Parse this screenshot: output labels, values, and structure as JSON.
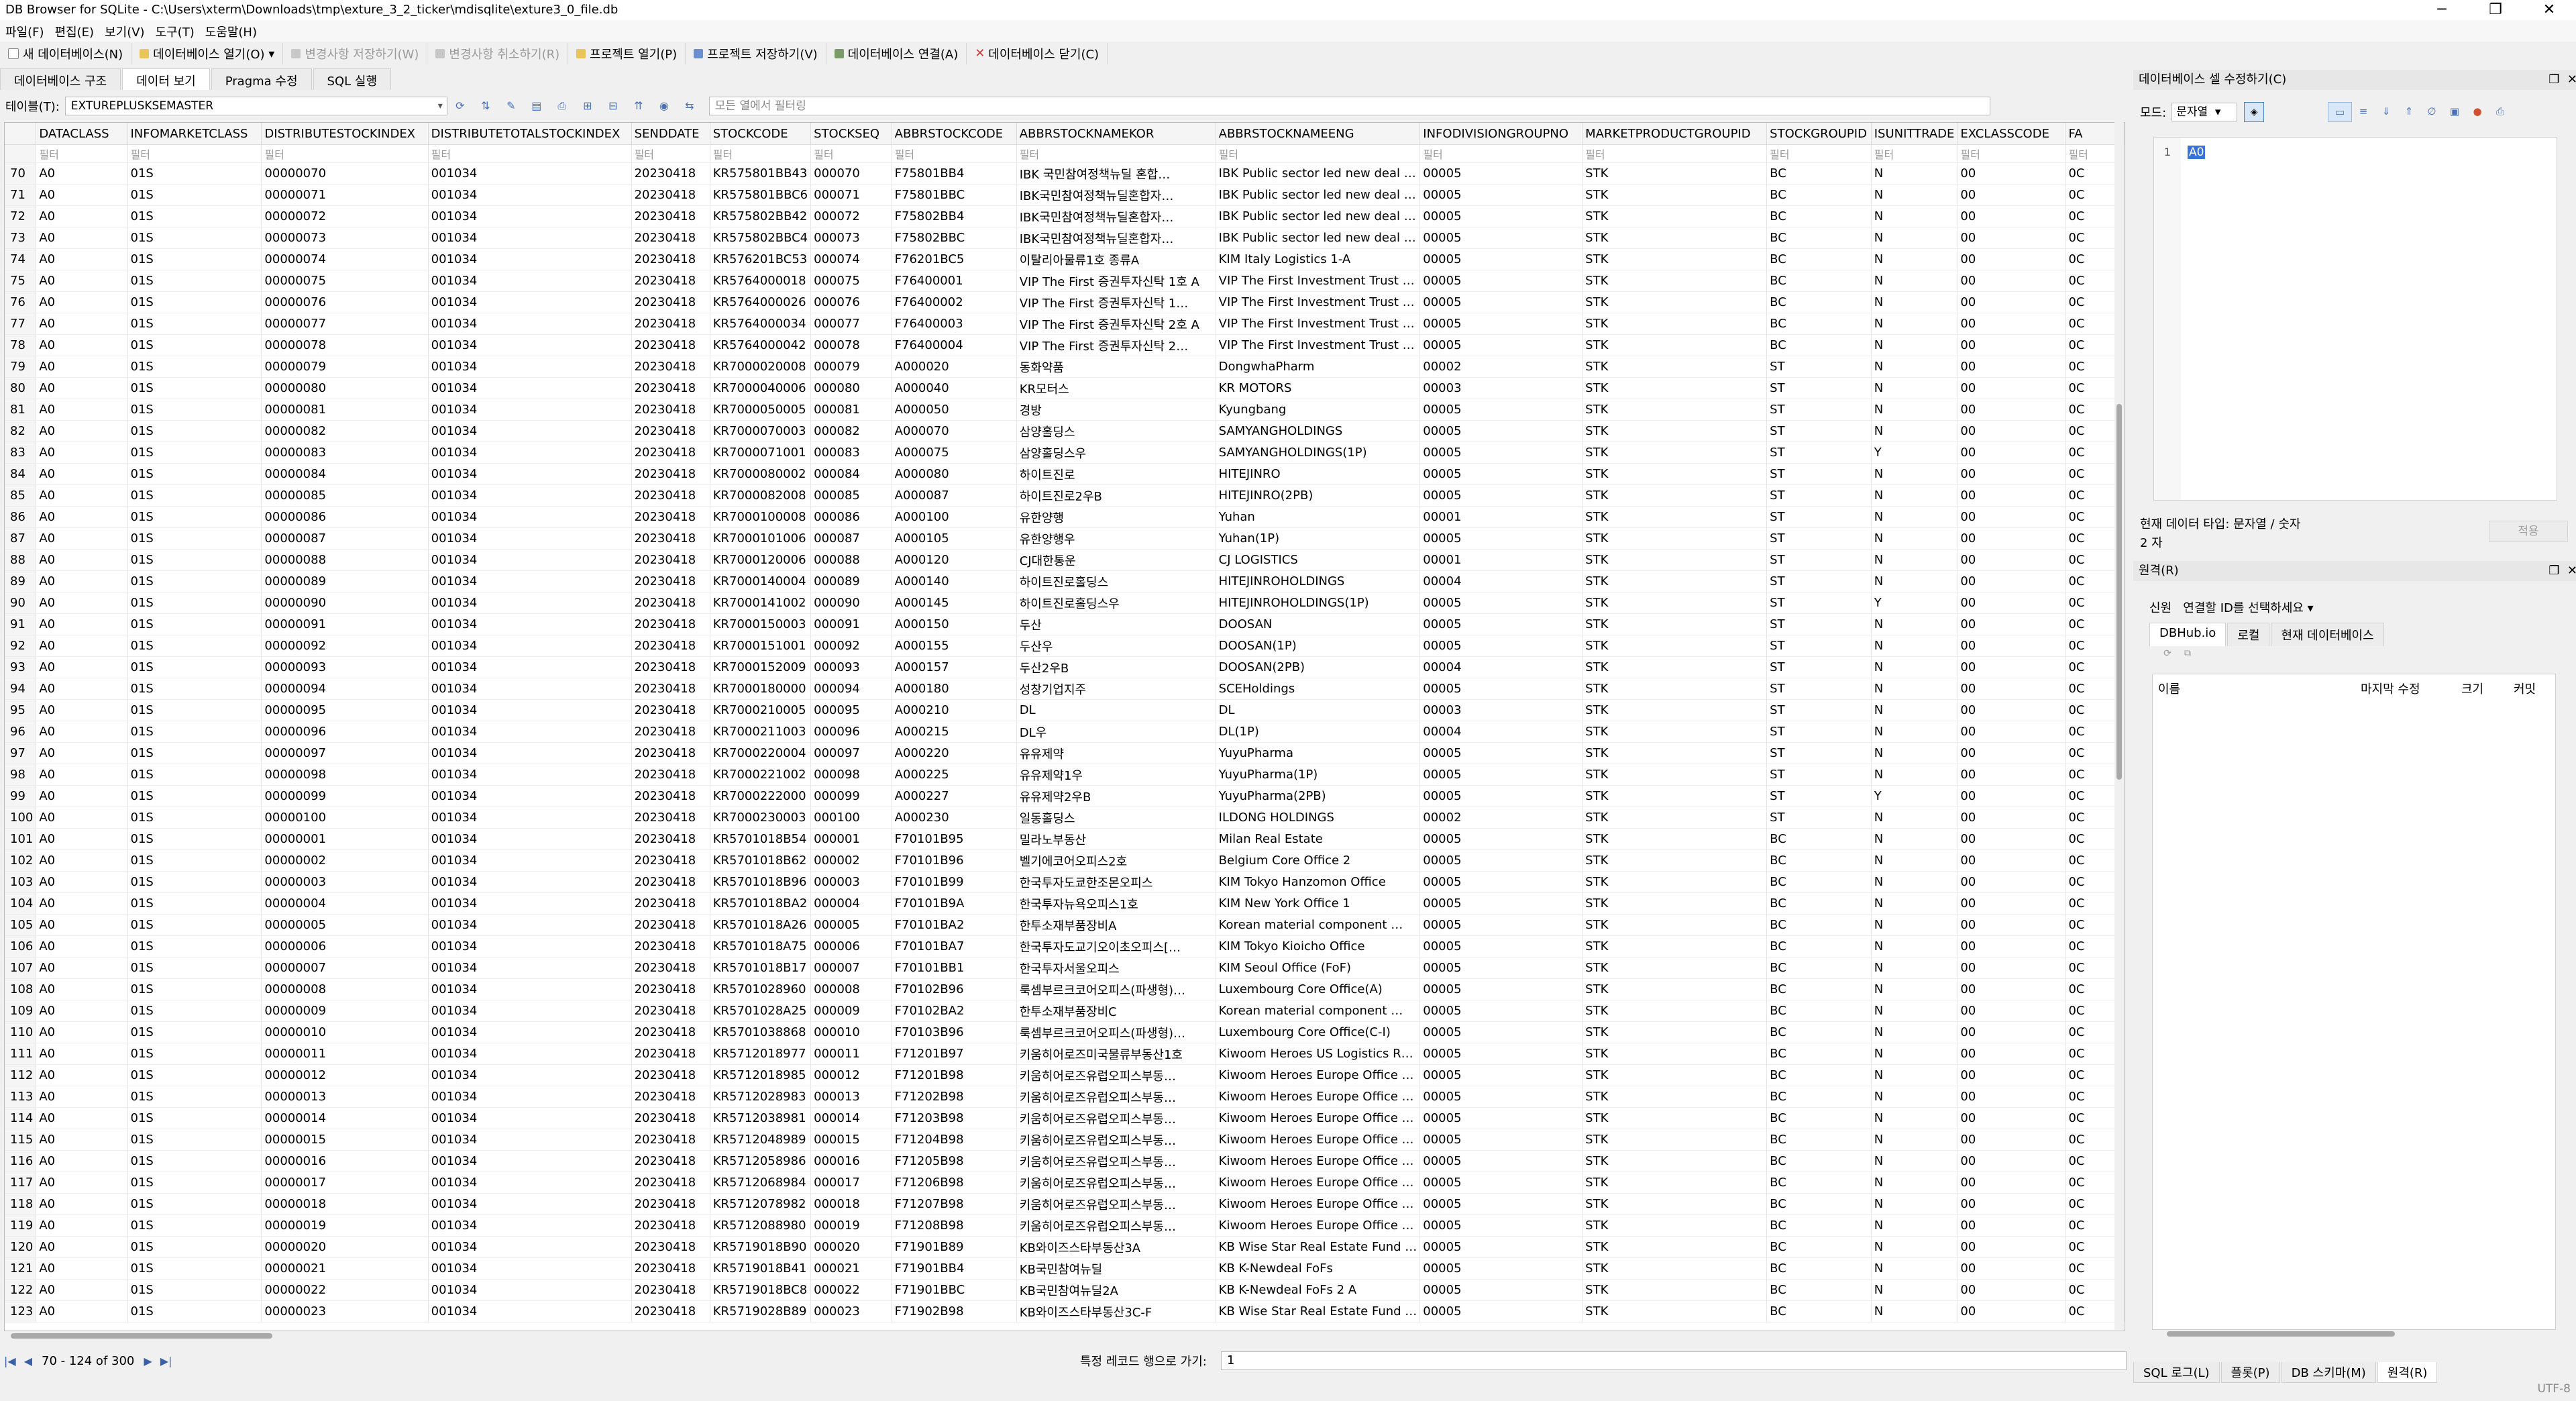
{
  "window": {
    "title": "DB Browser for SQLite - C:\\Users\\xterm\\Downloads\\tmp\\exture_3_2_ticker\\mdisqlite\\exture3_0_file.db",
    "min": "─",
    "max": "❐",
    "close": "✕"
  },
  "menu": [
    "파일(F)",
    "편집(E)",
    "보기(V)",
    "도구(T)",
    "도움말(H)"
  ],
  "toolbar": {
    "new_db": "새 데이터베이스(N)",
    "open_db": "데이터베이스 열기(O)",
    "write_changes": "변경사항 저장하기(W)",
    "revert_changes": "변경사항 취소하기(R)",
    "open_project": "프로젝트 열기(P)",
    "save_project": "프로젝트 저장하기(V)",
    "attach_db": "데이터베이스 연결(A)",
    "close_db": "데이터베이스 닫기(C)"
  },
  "tabs": [
    "데이터베이스 구조",
    "데이터 보기",
    "Pragma 수정",
    "SQL 실행"
  ],
  "browse": {
    "table_label": "테이블(T):",
    "table_value": "EXTUREPLUSKSEMASTER",
    "filter_placeholder": "모든 열에서 필터링"
  },
  "grid": {
    "columns": [
      "DATACLASS",
      "INFOMARKETCLASS",
      "DISTRIBUTESTOCKINDEX",
      "DISTRIBUTETOTALSTOCKINDEX",
      "SENDDATE",
      "STOCKCODE",
      "STOCKSEQ",
      "ABBRSTOCKCODE",
      "ABBRSTOCKNAMEKOR",
      "ABBRSTOCKNAMEENG",
      "INFODIVISIONGROUPNO",
      "MARKETPRODUCTGROUPID",
      "STOCKGROUPID",
      "ISUNITTRADE",
      "EXCLASSCODE",
      "FA"
    ],
    "filter_text": "필터",
    "rows": [
      [
        "70",
        "A0",
        "01S",
        "00000070",
        "001034",
        "20230418",
        "KR575801BB43",
        "000070",
        "F75801BB4",
        "IBK 국민참여정책뉴딜 혼합…",
        "IBK Public sector led new deal …",
        "00005",
        "STK",
        "BC",
        "N",
        "00",
        "0C"
      ],
      [
        "71",
        "A0",
        "01S",
        "00000071",
        "001034",
        "20230418",
        "KR575801BBC6",
        "000071",
        "F75801BBC",
        "IBK국민참여정책뉴딜혼합자…",
        "IBK Public sector led new deal …",
        "00005",
        "STK",
        "BC",
        "N",
        "00",
        "0C"
      ],
      [
        "72",
        "A0",
        "01S",
        "00000072",
        "001034",
        "20230418",
        "KR575802BB42",
        "000072",
        "F75802BB4",
        "IBK국민참여정책뉴딜혼합자…",
        "IBK Public sector led new deal …",
        "00005",
        "STK",
        "BC",
        "N",
        "00",
        "0C"
      ],
      [
        "73",
        "A0",
        "01S",
        "00000073",
        "001034",
        "20230418",
        "KR575802BBC4",
        "000073",
        "F75802BBC",
        "IBK국민참여정책뉴딜혼합자…",
        "IBK Public sector led new deal …",
        "00005",
        "STK",
        "BC",
        "N",
        "00",
        "0C"
      ],
      [
        "74",
        "A0",
        "01S",
        "00000074",
        "001034",
        "20230418",
        "KR576201BC53",
        "000074",
        "F76201BC5",
        "이탈리아물류1호 종류A",
        "KIM Italy Logistics 1-A",
        "00005",
        "STK",
        "BC",
        "N",
        "00",
        "0C"
      ],
      [
        "75",
        "A0",
        "01S",
        "00000075",
        "001034",
        "20230418",
        "KR5764000018",
        "000075",
        "F76400001",
        "VIP The First 증권투자신탁 1호 A",
        "VIP The First Investment Trust …",
        "00005",
        "STK",
        "BC",
        "N",
        "00",
        "0C"
      ],
      [
        "76",
        "A0",
        "01S",
        "00000076",
        "001034",
        "20230418",
        "KR5764000026",
        "000076",
        "F76400002",
        "VIP The First 증권투자신탁 1…",
        "VIP The First Investment Trust …",
        "00005",
        "STK",
        "BC",
        "N",
        "00",
        "0C"
      ],
      [
        "77",
        "A0",
        "01S",
        "00000077",
        "001034",
        "20230418",
        "KR5764000034",
        "000077",
        "F76400003",
        "VIP The First 증권투자신탁 2호 A",
        "VIP The First Investment Trust …",
        "00005",
        "STK",
        "BC",
        "N",
        "00",
        "0C"
      ],
      [
        "78",
        "A0",
        "01S",
        "00000078",
        "001034",
        "20230418",
        "KR5764000042",
        "000078",
        "F76400004",
        "VIP The First 증권투자신탁 2…",
        "VIP The First Investment Trust …",
        "00005",
        "STK",
        "BC",
        "N",
        "00",
        "0C"
      ],
      [
        "79",
        "A0",
        "01S",
        "00000079",
        "001034",
        "20230418",
        "KR7000020008",
        "000079",
        "A000020",
        "동화약품",
        "DongwhaPharm",
        "00002",
        "STK",
        "ST",
        "N",
        "00",
        "0C"
      ],
      [
        "80",
        "A0",
        "01S",
        "00000080",
        "001034",
        "20230418",
        "KR7000040006",
        "000080",
        "A000040",
        "KR모터스",
        "KR MOTORS",
        "00003",
        "STK",
        "ST",
        "N",
        "00",
        "0C"
      ],
      [
        "81",
        "A0",
        "01S",
        "00000081",
        "001034",
        "20230418",
        "KR7000050005",
        "000081",
        "A000050",
        "경방",
        "Kyungbang",
        "00005",
        "STK",
        "ST",
        "N",
        "00",
        "0C"
      ],
      [
        "82",
        "A0",
        "01S",
        "00000082",
        "001034",
        "20230418",
        "KR7000070003",
        "000082",
        "A000070",
        "삼양홀딩스",
        "SAMYANGHOLDINGS",
        "00005",
        "STK",
        "ST",
        "N",
        "00",
        "0C"
      ],
      [
        "83",
        "A0",
        "01S",
        "00000083",
        "001034",
        "20230418",
        "KR7000071001",
        "000083",
        "A000075",
        "삼양홀딩스우",
        "SAMYANGHOLDINGS(1P)",
        "00005",
        "STK",
        "ST",
        "Y",
        "00",
        "0C"
      ],
      [
        "84",
        "A0",
        "01S",
        "00000084",
        "001034",
        "20230418",
        "KR7000080002",
        "000084",
        "A000080",
        "하이트진로",
        "HITEJINRO",
        "00005",
        "STK",
        "ST",
        "N",
        "00",
        "0C"
      ],
      [
        "85",
        "A0",
        "01S",
        "00000085",
        "001034",
        "20230418",
        "KR7000082008",
        "000085",
        "A000087",
        "하이트진로2우B",
        "HITEJINRO(2PB)",
        "00005",
        "STK",
        "ST",
        "N",
        "00",
        "0C"
      ],
      [
        "86",
        "A0",
        "01S",
        "00000086",
        "001034",
        "20230418",
        "KR7000100008",
        "000086",
        "A000100",
        "유한양행",
        "Yuhan",
        "00001",
        "STK",
        "ST",
        "N",
        "00",
        "0C"
      ],
      [
        "87",
        "A0",
        "01S",
        "00000087",
        "001034",
        "20230418",
        "KR7000101006",
        "000087",
        "A000105",
        "유한양행우",
        "Yuhan(1P)",
        "00005",
        "STK",
        "ST",
        "N",
        "00",
        "0C"
      ],
      [
        "88",
        "A0",
        "01S",
        "00000088",
        "001034",
        "20230418",
        "KR7000120006",
        "000088",
        "A000120",
        "CJ대한통운",
        "CJ LOGISTICS",
        "00001",
        "STK",
        "ST",
        "N",
        "00",
        "0C"
      ],
      [
        "89",
        "A0",
        "01S",
        "00000089",
        "001034",
        "20230418",
        "KR7000140004",
        "000089",
        "A000140",
        "하이트진로홀딩스",
        "HITEJINROHOLDINGS",
        "00004",
        "STK",
        "ST",
        "N",
        "00",
        "0C"
      ],
      [
        "90",
        "A0",
        "01S",
        "00000090",
        "001034",
        "20230418",
        "KR7000141002",
        "000090",
        "A000145",
        "하이트진로홀딩스우",
        "HITEJINROHOLDINGS(1P)",
        "00005",
        "STK",
        "ST",
        "Y",
        "00",
        "0C"
      ],
      [
        "91",
        "A0",
        "01S",
        "00000091",
        "001034",
        "20230418",
        "KR7000150003",
        "000091",
        "A000150",
        "두산",
        "DOOSAN",
        "00005",
        "STK",
        "ST",
        "N",
        "00",
        "0C"
      ],
      [
        "92",
        "A0",
        "01S",
        "00000092",
        "001034",
        "20230418",
        "KR7000151001",
        "000092",
        "A000155",
        "두산우",
        "DOOSAN(1P)",
        "00005",
        "STK",
        "ST",
        "N",
        "00",
        "0C"
      ],
      [
        "93",
        "A0",
        "01S",
        "00000093",
        "001034",
        "20230418",
        "KR7000152009",
        "000093",
        "A000157",
        "두산2우B",
        "DOOSAN(2PB)",
        "00004",
        "STK",
        "ST",
        "N",
        "00",
        "0C"
      ],
      [
        "94",
        "A0",
        "01S",
        "00000094",
        "001034",
        "20230418",
        "KR7000180000",
        "000094",
        "A000180",
        "성창기업지주",
        "SCEHoldings",
        "00005",
        "STK",
        "ST",
        "N",
        "00",
        "0C"
      ],
      [
        "95",
        "A0",
        "01S",
        "00000095",
        "001034",
        "20230418",
        "KR7000210005",
        "000095",
        "A000210",
        "DL",
        "DL",
        "00003",
        "STK",
        "ST",
        "N",
        "00",
        "0C"
      ],
      [
        "96",
        "A0",
        "01S",
        "00000096",
        "001034",
        "20230418",
        "KR7000211003",
        "000096",
        "A000215",
        "DL우",
        "DL(1P)",
        "00004",
        "STK",
        "ST",
        "N",
        "00",
        "0C"
      ],
      [
        "97",
        "A0",
        "01S",
        "00000097",
        "001034",
        "20230418",
        "KR7000220004",
        "000097",
        "A000220",
        "유유제약",
        "YuyuPharma",
        "00005",
        "STK",
        "ST",
        "N",
        "00",
        "0C"
      ],
      [
        "98",
        "A0",
        "01S",
        "00000098",
        "001034",
        "20230418",
        "KR7000221002",
        "000098",
        "A000225",
        "유유제약1우",
        "YuyuPharma(1P)",
        "00005",
        "STK",
        "ST",
        "N",
        "00",
        "0C"
      ],
      [
        "99",
        "A0",
        "01S",
        "00000099",
        "001034",
        "20230418",
        "KR7000222000",
        "000099",
        "A000227",
        "유유제약2우B",
        "YuyuPharma(2PB)",
        "00005",
        "STK",
        "ST",
        "Y",
        "00",
        "0C"
      ],
      [
        "100",
        "A0",
        "01S",
        "00000100",
        "001034",
        "20230418",
        "KR7000230003",
        "000100",
        "A000230",
        "일동홀딩스",
        "ILDONG HOLDINGS",
        "00002",
        "STK",
        "ST",
        "N",
        "00",
        "0C"
      ],
      [
        "101",
        "A0",
        "01S",
        "00000001",
        "001034",
        "20230418",
        "KR5701018B54",
        "000001",
        "F70101B95",
        "밀라노부동산",
        "Milan Real Estate",
        "00005",
        "STK",
        "BC",
        "N",
        "00",
        "0C"
      ],
      [
        "102",
        "A0",
        "01S",
        "00000002",
        "001034",
        "20230418",
        "KR5701018B62",
        "000002",
        "F70101B96",
        "벨기에코어오피스2호",
        "Belgium Core Office 2",
        "00005",
        "STK",
        "BC",
        "N",
        "00",
        "0C"
      ],
      [
        "103",
        "A0",
        "01S",
        "00000003",
        "001034",
        "20230418",
        "KR5701018B96",
        "000003",
        "F70101B99",
        "한국투자도쿄한조몬오피스",
        "KIM Tokyo Hanzomon Office",
        "00005",
        "STK",
        "BC",
        "N",
        "00",
        "0C"
      ],
      [
        "104",
        "A0",
        "01S",
        "00000004",
        "001034",
        "20230418",
        "KR5701018BA2",
        "000004",
        "F70101B9A",
        "한국투자뉴욕오피스1호",
        "KIM New York Office 1",
        "00005",
        "STK",
        "BC",
        "N",
        "00",
        "0C"
      ],
      [
        "105",
        "A0",
        "01S",
        "00000005",
        "001034",
        "20230418",
        "KR5701018A26",
        "000005",
        "F70101BA2",
        "한투소재부품장비A",
        "Korean material component …",
        "00005",
        "STK",
        "BC",
        "N",
        "00",
        "0C"
      ],
      [
        "106",
        "A0",
        "01S",
        "00000006",
        "001034",
        "20230418",
        "KR5701018A75",
        "000006",
        "F70101BA7",
        "한국투자도교기오이초오피스[…",
        "KIM Tokyo Kioicho Office",
        "00005",
        "STK",
        "BC",
        "N",
        "00",
        "0C"
      ],
      [
        "107",
        "A0",
        "01S",
        "00000007",
        "001034",
        "20230418",
        "KR5701018B17",
        "000007",
        "F70101BB1",
        "한국투자서울오피스",
        "KIM Seoul Office (FoF)",
        "00005",
        "STK",
        "BC",
        "N",
        "00",
        "0C"
      ],
      [
        "108",
        "A0",
        "01S",
        "00000008",
        "001034",
        "20230418",
        "KR5701028960",
        "000008",
        "F70102B96",
        "룩셈부르크코어오피스(파생형)…",
        "Luxembourg Core Office(A)",
        "00005",
        "STK",
        "BC",
        "N",
        "00",
        "0C"
      ],
      [
        "109",
        "A0",
        "01S",
        "00000009",
        "001034",
        "20230418",
        "KR5701028A25",
        "000009",
        "F70102BA2",
        "한투소재부품장비C",
        "Korean material component …",
        "00005",
        "STK",
        "BC",
        "N",
        "00",
        "0C"
      ],
      [
        "110",
        "A0",
        "01S",
        "00000010",
        "001034",
        "20230418",
        "KR5701038868",
        "000010",
        "F70103B96",
        "룩셈부르크코어오피스(파생형)…",
        "Luxembourg Core Office(C-I)",
        "00005",
        "STK",
        "BC",
        "N",
        "00",
        "0C"
      ],
      [
        "111",
        "A0",
        "01S",
        "00000011",
        "001034",
        "20230418",
        "KR5712018977",
        "000011",
        "F71201B97",
        "키움히어로즈미국물류부동산1호",
        "Kiwoom Heroes US Logistics R…",
        "00005",
        "STK",
        "BC",
        "N",
        "00",
        "0C"
      ],
      [
        "112",
        "A0",
        "01S",
        "00000012",
        "001034",
        "20230418",
        "KR5712018985",
        "000012",
        "F71201B98",
        "키움히어로즈유럽오피스부동…",
        "Kiwoom Heroes Europe Office …",
        "00005",
        "STK",
        "BC",
        "N",
        "00",
        "0C"
      ],
      [
        "113",
        "A0",
        "01S",
        "00000013",
        "001034",
        "20230418",
        "KR5712028983",
        "000013",
        "F71202B98",
        "키움히어로즈유럽오피스부동…",
        "Kiwoom Heroes Europe Office …",
        "00005",
        "STK",
        "BC",
        "N",
        "00",
        "0C"
      ],
      [
        "114",
        "A0",
        "01S",
        "00000014",
        "001034",
        "20230418",
        "KR5712038981",
        "000014",
        "F71203B98",
        "키움히어로즈유럽오피스부동…",
        "Kiwoom Heroes Europe Office …",
        "00005",
        "STK",
        "BC",
        "N",
        "00",
        "0C"
      ],
      [
        "115",
        "A0",
        "01S",
        "00000015",
        "001034",
        "20230418",
        "KR5712048989",
        "000015",
        "F71204B98",
        "키움히어로즈유럽오피스부동…",
        "Kiwoom Heroes Europe Office …",
        "00005",
        "STK",
        "BC",
        "N",
        "00",
        "0C"
      ],
      [
        "116",
        "A0",
        "01S",
        "00000016",
        "001034",
        "20230418",
        "KR5712058986",
        "000016",
        "F71205B98",
        "키움히어로즈유럽오피스부동…",
        "Kiwoom Heroes Europe Office …",
        "00005",
        "STK",
        "BC",
        "N",
        "00",
        "0C"
      ],
      [
        "117",
        "A0",
        "01S",
        "00000017",
        "001034",
        "20230418",
        "KR5712068984",
        "000017",
        "F71206B98",
        "키움히어로즈유럽오피스부동…",
        "Kiwoom Heroes Europe Office …",
        "00005",
        "STK",
        "BC",
        "N",
        "00",
        "0C"
      ],
      [
        "118",
        "A0",
        "01S",
        "00000018",
        "001034",
        "20230418",
        "KR5712078982",
        "000018",
        "F71207B98",
        "키움히어로즈유럽오피스부동…",
        "Kiwoom Heroes Europe Office …",
        "00005",
        "STK",
        "BC",
        "N",
        "00",
        "0C"
      ],
      [
        "119",
        "A0",
        "01S",
        "00000019",
        "001034",
        "20230418",
        "KR5712088980",
        "000019",
        "F71208B98",
        "키움히어로즈유럽오피스부동…",
        "Kiwoom Heroes Europe Office …",
        "00005",
        "STK",
        "BC",
        "N",
        "00",
        "0C"
      ],
      [
        "120",
        "A0",
        "01S",
        "00000020",
        "001034",
        "20230418",
        "KR5719018B90",
        "000020",
        "F71901B89",
        "KB와이즈스타부동산3A",
        "KB Wise Star Real Estate Fund …",
        "00005",
        "STK",
        "BC",
        "N",
        "00",
        "0C"
      ],
      [
        "121",
        "A0",
        "01S",
        "00000021",
        "001034",
        "20230418",
        "KR5719018B41",
        "000021",
        "F71901BB4",
        "KB국민참여뉴딜",
        "KB K-Newdeal FoFs",
        "00005",
        "STK",
        "BC",
        "N",
        "00",
        "0C"
      ],
      [
        "122",
        "A0",
        "01S",
        "00000022",
        "001034",
        "20230418",
        "KR5719018BC8",
        "000022",
        "F71901BBC",
        "KB국민참여뉴딜2A",
        "KB K-Newdeal FoFs 2 A",
        "00005",
        "STK",
        "BC",
        "N",
        "00",
        "0C"
      ],
      [
        "123",
        "A0",
        "01S",
        "00000023",
        "001034",
        "20230418",
        "KR5719028B89",
        "000023",
        "F71902B98",
        "KB와이즈스타부동산3C-F",
        "KB Wise Star Real Estate Fund …",
        "00005",
        "STK",
        "BC",
        "N",
        "00",
        "0C"
      ]
    ]
  },
  "nav": {
    "record_info": "70 - 124 of 300",
    "goto_label": "특정 레코드 행으로 가기:",
    "goto_value": "1"
  },
  "edit_cell": {
    "title": "데이터베이스 셀 수정하기(C)",
    "mode_label": "모드:",
    "mode_value": "문자열",
    "line_no": "1",
    "value": "A0",
    "type_info": "현재 데이터 타입: 문자열 / 숫자",
    "size_info": "2 자",
    "apply": "적용"
  },
  "remote": {
    "title": "원격(R)",
    "identity_label": "신원",
    "identity_value": "연결할 ID를 선택하세요",
    "tabs": [
      "DBHub.io",
      "로컬",
      "현재 데이터베이스"
    ],
    "columns": [
      "이름",
      "마지막 수정",
      "크기",
      "커밋"
    ]
  },
  "bottom_tabs": [
    "SQL 로그(L)",
    "플롯(P)",
    "DB 스키마(M)",
    "원격(R)"
  ],
  "status": {
    "encoding": "UTF-8"
  }
}
